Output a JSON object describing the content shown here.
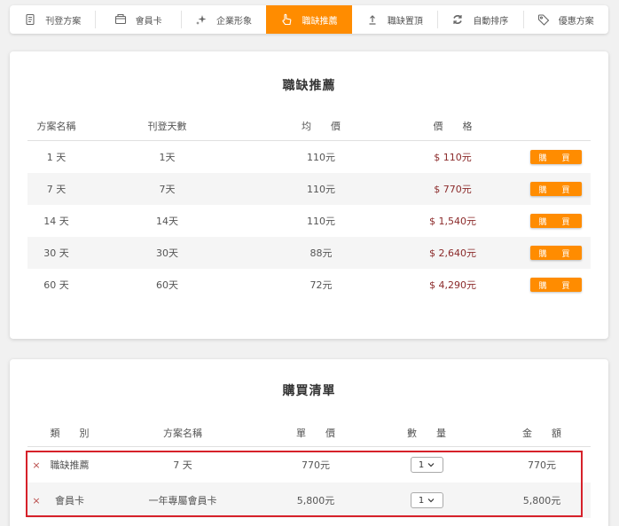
{
  "nav": {
    "items": [
      {
        "label": "刊登方案",
        "icon": "document-icon",
        "active": false
      },
      {
        "label": "會員卡",
        "icon": "card-icon",
        "active": false
      },
      {
        "label": "企業形象",
        "icon": "sparkle-icon",
        "active": false
      },
      {
        "label": "職缺推薦",
        "icon": "hand-pointer-icon",
        "active": true
      },
      {
        "label": "職缺置頂",
        "icon": "arrow-up-icon",
        "active": false
      },
      {
        "label": "自動排序",
        "icon": "sync-icon",
        "active": false
      },
      {
        "label": "優惠方案",
        "icon": "tag-icon",
        "active": false
      }
    ]
  },
  "pricing": {
    "title": "職缺推薦",
    "headers": [
      "方案名稱",
      "刊登天數",
      "均　　價",
      "價　　格"
    ],
    "rows": [
      {
        "plan": "1 天",
        "days": "1天",
        "avg": "110元",
        "price": "$ 110元",
        "buy": "購　買"
      },
      {
        "plan": "7 天",
        "days": "7天",
        "avg": "110元",
        "price": "$ 770元",
        "buy": "購　買"
      },
      {
        "plan": "14 天",
        "days": "14天",
        "avg": "110元",
        "price": "$ 1,540元",
        "buy": "購　買"
      },
      {
        "plan": "30 天",
        "days": "30天",
        "avg": "88元",
        "price": "$ 2,640元",
        "buy": "購　買"
      },
      {
        "plan": "60 天",
        "days": "60天",
        "avg": "72元",
        "price": "$ 4,290元",
        "buy": "購　買"
      }
    ]
  },
  "cart": {
    "title": "購買清單",
    "headers": [
      "類　　別",
      "方案名稱",
      "單　　價",
      "數　　量",
      "金　　額"
    ],
    "remove_symbol": "×",
    "items": [
      {
        "category": "職缺推薦",
        "plan": "7 天",
        "unit_price": "770元",
        "qty": "1",
        "amount": "770元"
      },
      {
        "category": "會員卡",
        "plan": "一年專屬會員卡",
        "unit_price": "5,800元",
        "qty": "1",
        "amount": "5,800元"
      }
    ]
  },
  "colors": {
    "accent": "#ff8c00",
    "price": "#8b2a2a",
    "highlight": "#d6212a"
  }
}
